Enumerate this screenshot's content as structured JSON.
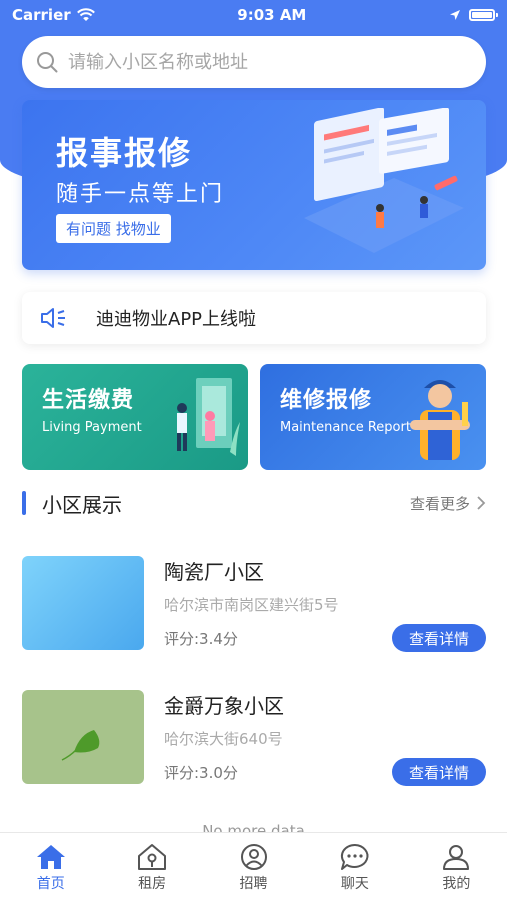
{
  "status_bar": {
    "carrier": "Carrier",
    "time": "9:03 AM"
  },
  "search": {
    "placeholder": "请输入小区名称或地址"
  },
  "banner": {
    "title": "报事报修",
    "subtitle": "随手一点等上门",
    "tag": "有问题 找物业"
  },
  "notice": {
    "text": "迪迪物业APP上线啦"
  },
  "service_cards": [
    {
      "title": "生活缴费",
      "subtitle": "Living Payment"
    },
    {
      "title": "维修报修",
      "subtitle": "Maintenance Report"
    }
  ],
  "section": {
    "title": "小区展示",
    "more_label": "查看更多"
  },
  "communities": [
    {
      "name": "陶瓷厂小区",
      "address": "哈尔滨市南岗区建兴街5号",
      "score": "评分:3.4分",
      "button": "查看详情"
    },
    {
      "name": "金爵万象小区",
      "address": "哈尔滨大街640号",
      "score": "评分:3.0分",
      "button": "查看详情"
    }
  ],
  "footer_note": "No more data",
  "tabbar": [
    {
      "label": "首页",
      "icon": "home-icon",
      "active": true
    },
    {
      "label": "租房",
      "icon": "house-rent-icon",
      "active": false
    },
    {
      "label": "招聘",
      "icon": "recruit-icon",
      "active": false
    },
    {
      "label": "聊天",
      "icon": "chat-icon",
      "active": false
    },
    {
      "label": "我的",
      "icon": "profile-icon",
      "active": false
    }
  ],
  "colors": {
    "primary": "#3a6ee8",
    "teal": "#23a890",
    "background": "#ffffff"
  }
}
